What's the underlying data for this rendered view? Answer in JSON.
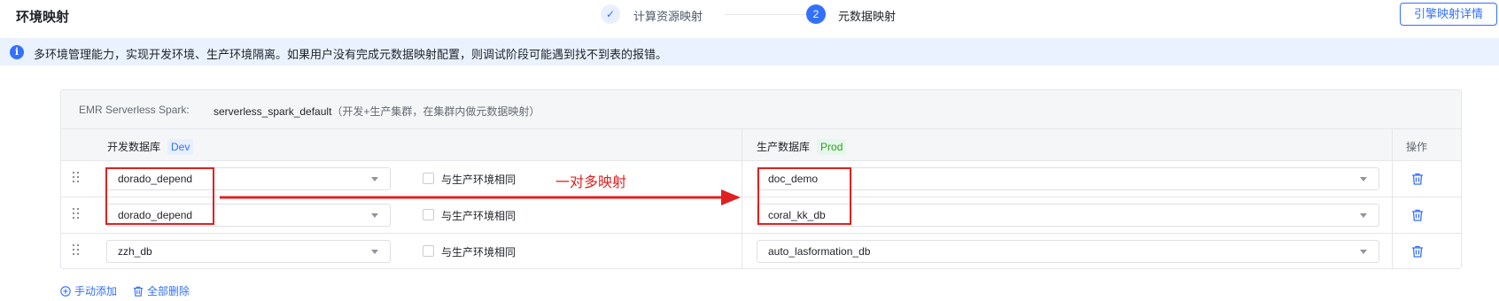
{
  "header": {
    "title": "环境映射",
    "steps": [
      {
        "label": "计算资源映射",
        "status": "done",
        "mark": "✓"
      },
      {
        "label": "元数据映射",
        "status": "active",
        "number": "2"
      }
    ],
    "engine_button": "引擎映射详情"
  },
  "banner": {
    "icon": "info-icon",
    "icon_glyph": "i",
    "text": "多环境管理能力，实现开发环境、生产环境隔离。如果用户没有完成元数据映射配置，则调试阶段可能遇到找不到表的报错。"
  },
  "cluster": {
    "label": "EMR Serverless Spark:",
    "value": "serverless_spark_default",
    "description": "（开发+生产集群，在集群内做元数据映射）"
  },
  "table": {
    "columns": {
      "dev": "开发数据库",
      "dev_tag": "Dev",
      "prod": "生产数据库",
      "prod_tag": "Prod",
      "operation": "操作"
    },
    "rows": [
      {
        "dev_db": "dorado_depend",
        "same_env_label": "与生产环境相同",
        "same_env_checked": false,
        "prod_db": "doc_demo"
      },
      {
        "dev_db": "dorado_depend",
        "same_env_label": "与生产环境相同",
        "same_env_checked": false,
        "prod_db": "coral_kk_db"
      },
      {
        "dev_db": "zzh_db",
        "same_env_label": "与生产环境相同",
        "same_env_checked": false,
        "prod_db": "auto_lasformation_db"
      }
    ]
  },
  "actions": {
    "add": "手动添加",
    "delete_all": "全部删除"
  },
  "annotation": {
    "text": "一对多映射",
    "color": "#e02020"
  },
  "colors": {
    "primary": "#3370ff",
    "banner_bg": "#eaf2ff",
    "prod_tag": "#2ea121",
    "annotation": "#e02020"
  }
}
